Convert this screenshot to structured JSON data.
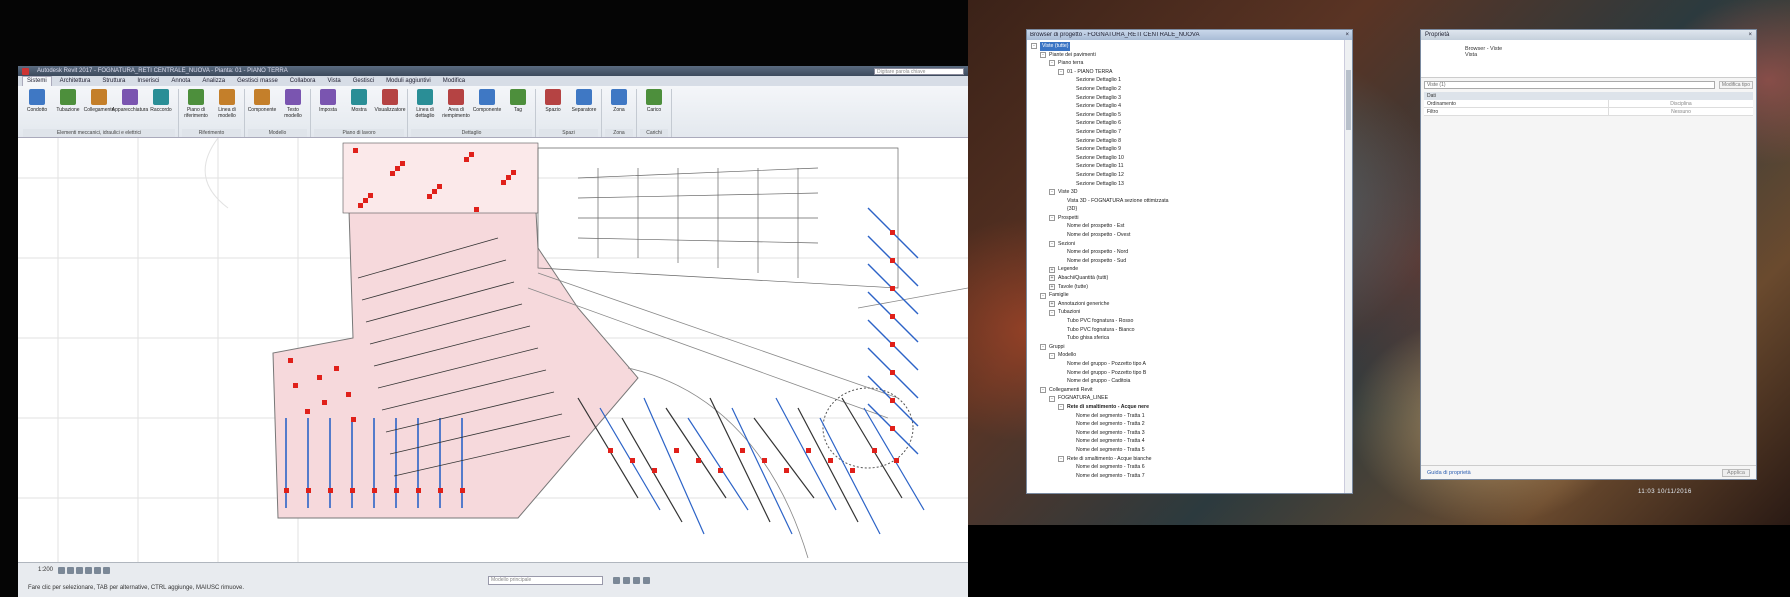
{
  "revit": {
    "title": "Autodesk Revit 2017 - FOGNATURA_RETI CENTRALE_NUOVA - Pianta: 01 - PIANO TERRA",
    "search_placeholder": "Digitare parola chiave",
    "tabs": [
      "Sistemi",
      "Architettura",
      "Struttura",
      "Inserisci",
      "Annota",
      "Analizza",
      "Gestisci masse",
      "Collabora",
      "Vista",
      "Gestisci",
      "Moduli aggiuntivi",
      "Modifica"
    ],
    "active_tab": "Sistemi",
    "panels": [
      {
        "title": "Elementi meccanici, idraulici e elettrici",
        "buttons": [
          "Condotto",
          "Tubazione",
          "Collegamento",
          "Apparecchiatura",
          "Raccordo"
        ]
      },
      {
        "title": "Riferimento",
        "buttons": [
          "Piano di riferimento",
          "Linea di modello"
        ]
      },
      {
        "title": "Modello",
        "buttons": [
          "Componente",
          "Testo modello"
        ]
      },
      {
        "title": "Piano di lavoro",
        "buttons": [
          "Imposta",
          "Mostra",
          "Visualizzatore"
        ]
      },
      {
        "title": "Dettaglio",
        "buttons": [
          "Linea di dettaglio",
          "Area di riempimento",
          "Componente",
          "Tag"
        ]
      },
      {
        "title": "Spazi",
        "buttons": [
          "Spazio",
          "Separatore"
        ]
      },
      {
        "title": "Zona",
        "buttons": [
          "Zona"
        ]
      },
      {
        "title": "Carichi",
        "buttons": [
          "Carico"
        ]
      }
    ],
    "status_text": "Fare clic per selezionare, TAB per alternative, CTRL aggiunge, MAIUSC rimuove.",
    "status_input": "Modello principale",
    "view_scale": "1:200"
  },
  "project_browser": {
    "title": "Browser di progetto - FOGNATURA_RETI CENTRALE_NUOVA",
    "close_glyph": "×",
    "tree": [
      {
        "depth": 0,
        "exp": "-",
        "label": "Viste (tutte)",
        "selected": true
      },
      {
        "depth": 1,
        "exp": "-",
        "label": "Piante dei pavimenti"
      },
      {
        "depth": 2,
        "exp": "-",
        "label": "Piano terra"
      },
      {
        "depth": 3,
        "exp": "-",
        "label": "01 - PIANO TERRA"
      },
      {
        "depth": 4,
        "exp": "",
        "label": "Sezione Dettaglio 1"
      },
      {
        "depth": 4,
        "exp": "",
        "label": "Sezione Dettaglio 2"
      },
      {
        "depth": 4,
        "exp": "",
        "label": "Sezione Dettaglio 3"
      },
      {
        "depth": 4,
        "exp": "",
        "label": "Sezione Dettaglio 4"
      },
      {
        "depth": 4,
        "exp": "",
        "label": "Sezione Dettaglio 5"
      },
      {
        "depth": 4,
        "exp": "",
        "label": "Sezione Dettaglio 6"
      },
      {
        "depth": 4,
        "exp": "",
        "label": "Sezione Dettaglio 7"
      },
      {
        "depth": 4,
        "exp": "",
        "label": "Sezione Dettaglio 8"
      },
      {
        "depth": 4,
        "exp": "",
        "label": "Sezione Dettaglio 9"
      },
      {
        "depth": 4,
        "exp": "",
        "label": "Sezione Dettaglio 10"
      },
      {
        "depth": 4,
        "exp": "",
        "label": "Sezione Dettaglio 11"
      },
      {
        "depth": 4,
        "exp": "",
        "label": "Sezione Dettaglio 12"
      },
      {
        "depth": 4,
        "exp": "",
        "label": "Sezione Dettaglio 13"
      },
      {
        "depth": 2,
        "exp": "-",
        "label": "Viste 3D"
      },
      {
        "depth": 3,
        "exp": "",
        "label": "Vista 3D - FOGNATURA sezione ottimizzata"
      },
      {
        "depth": 3,
        "exp": "",
        "label": "{3D}"
      },
      {
        "depth": 2,
        "exp": "-",
        "label": "Prospetti"
      },
      {
        "depth": 3,
        "exp": "",
        "label": "Nome del prospetto - Est"
      },
      {
        "depth": 3,
        "exp": "",
        "label": "Nome del prospetto - Ovest"
      },
      {
        "depth": 2,
        "exp": "-",
        "label": "Sezioni"
      },
      {
        "depth": 3,
        "exp": "",
        "label": "Nome del prospetto - Nord"
      },
      {
        "depth": 3,
        "exp": "",
        "label": "Nome del prospetto - Sud"
      },
      {
        "depth": 2,
        "exp": "+",
        "label": "Legende"
      },
      {
        "depth": 2,
        "exp": "+",
        "label": "Abachi/Quantità (tutti)"
      },
      {
        "depth": 2,
        "exp": "+",
        "label": "Tavole (tutte)"
      },
      {
        "depth": 1,
        "exp": "-",
        "label": "Famiglie"
      },
      {
        "depth": 2,
        "exp": "+",
        "label": "Annotazioni generiche"
      },
      {
        "depth": 2,
        "exp": "-",
        "label": "Tubazioni"
      },
      {
        "depth": 3,
        "exp": "",
        "label": "Tubo PVC fognatura - Rosso"
      },
      {
        "depth": 3,
        "exp": "",
        "label": "Tubo PVC fognatura - Bianco"
      },
      {
        "depth": 3,
        "exp": "",
        "label": "Tubo ghisa sferica"
      },
      {
        "depth": 1,
        "exp": "-",
        "label": "Gruppi"
      },
      {
        "depth": 2,
        "exp": "-",
        "label": "Modello"
      },
      {
        "depth": 3,
        "exp": "",
        "label": "Nome del gruppo - Pozzetto tipo A"
      },
      {
        "depth": 3,
        "exp": "",
        "label": "Nome del gruppo - Pozzetto tipo B"
      },
      {
        "depth": 3,
        "exp": "",
        "label": "Nome del gruppo - Caditoia"
      },
      {
        "depth": 1,
        "exp": "-",
        "label": "Collegamenti Revit"
      },
      {
        "depth": 2,
        "exp": "-",
        "label": "FOGNATURA_LINEE"
      },
      {
        "depth": 3,
        "exp": "-",
        "label": "Rete di smaltimento - Acque nere",
        "bold": true
      },
      {
        "depth": 4,
        "exp": "",
        "label": "Nome del segmento - Tratta 1"
      },
      {
        "depth": 4,
        "exp": "",
        "label": "Nome del segmento - Tratta 2"
      },
      {
        "depth": 4,
        "exp": "",
        "label": "Nome del segmento - Tratta 3"
      },
      {
        "depth": 4,
        "exp": "",
        "label": "Nome del segmento - Tratta 4"
      },
      {
        "depth": 4,
        "exp": "",
        "label": "Nome del segmento - Tratta 5"
      },
      {
        "depth": 3,
        "exp": "-",
        "label": "Rete di smaltimento - Acque bianche"
      },
      {
        "depth": 4,
        "exp": "",
        "label": "Nome del segmento - Tratta 6"
      },
      {
        "depth": 4,
        "exp": "",
        "label": "Nome del segmento - Tratta 7"
      }
    ]
  },
  "properties": {
    "title": "Proprietà",
    "close_glyph": "×",
    "type_line1": "Browser - Viste",
    "type_line2": "Vista",
    "filter_value": "Viste (1)",
    "edit_type": "Modifica tipo",
    "group": "Dati",
    "rows": [
      {
        "key": "Ordinamento",
        "value": "Disciplina"
      },
      {
        "key": "Filtro",
        "value": "Nessuno"
      }
    ],
    "help_link": "Guida di proprietà",
    "apply_button": "Applica"
  },
  "desktop": {
    "clock": "11:03  10/11/2016"
  },
  "colors": {
    "selection": "#3a74c4",
    "pipe_red": "#e0201a",
    "pipe_blue": "#2c63c7",
    "fill_pink": "#f6d9dc"
  }
}
